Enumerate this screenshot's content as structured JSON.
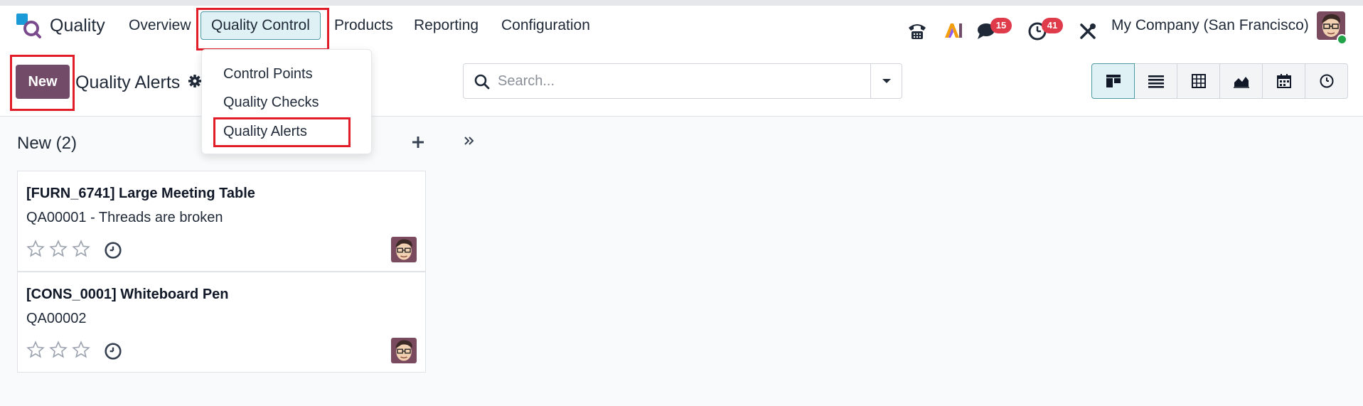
{
  "app": {
    "name": "Quality"
  },
  "nav": {
    "overview": "Overview",
    "quality_control": "Quality Control",
    "products": "Products",
    "reporting": "Reporting",
    "configuration": "Configuration"
  },
  "systray": {
    "phone_icon": "phone-icon",
    "ai_icon": "AI",
    "messages_badge": "15",
    "activities_badge": "41",
    "company": "My Company (San Francisco)"
  },
  "control": {
    "new_label": "New",
    "breadcrumb": "Quality Alerts",
    "search_placeholder": "Search..."
  },
  "dropdown": {
    "items": [
      "Control Points",
      "Quality Checks",
      "Quality Alerts"
    ]
  },
  "kanban": {
    "column_title": "New (2)",
    "cards": [
      {
        "title": "[FURN_6741] Large Meeting Table",
        "subtitle": "QA00001 - Threads are broken"
      },
      {
        "title": "[CONS_0001] Whiteboard Pen",
        "subtitle": "QA00002"
      }
    ]
  },
  "colors": {
    "brand": "#714b67",
    "accent": "#4b9aa4",
    "highlight": "#e11d2a",
    "badge": "#e03b4b"
  }
}
